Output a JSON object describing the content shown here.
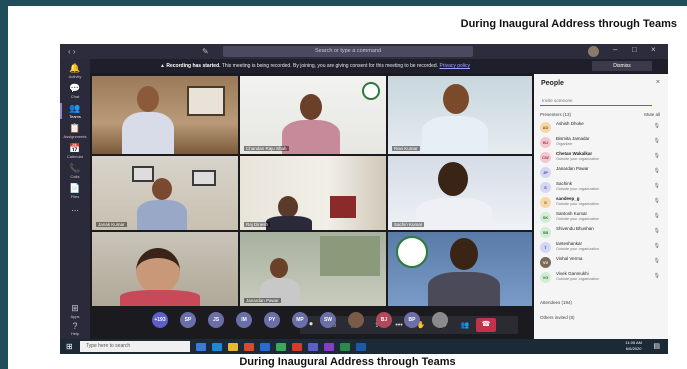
{
  "captions": {
    "top": "During Inaugural Address through Teams",
    "bottom": "During Inaugural Address through Teams"
  },
  "titlebar": {
    "search_placeholder": "Search or type a command"
  },
  "rail": [
    {
      "label": "Activity",
      "icon": "bell-icon"
    },
    {
      "label": "Chat",
      "icon": "chat-icon"
    },
    {
      "label": "Teams",
      "icon": "teams-icon",
      "active": true
    },
    {
      "label": "Assignments",
      "icon": "assignments-icon"
    },
    {
      "label": "Calendar",
      "icon": "calendar-icon"
    },
    {
      "label": "Calls",
      "icon": "phone-icon"
    },
    {
      "label": "Files",
      "icon": "files-icon"
    },
    {
      "label": "...",
      "icon": "more-icon"
    },
    {
      "label": "Apps",
      "icon": "apps-icon"
    },
    {
      "label": "Help",
      "icon": "help-icon"
    }
  ],
  "banner": {
    "bold": "Recording has started.",
    "text": " This meeting is being recorded. By joining, you are giving consent for this meeting to be recorded.",
    "link": "Privacy policy",
    "dismiss": "Dismiss"
  },
  "tiles": [
    {
      "name": ""
    },
    {
      "name": "Chandan Raju Shah"
    },
    {
      "name": "Ravi Kumar"
    },
    {
      "name": "Janak Kumar"
    },
    {
      "name": "Raj Dinesh"
    },
    {
      "name": "Sachin Kumar"
    },
    {
      "name": ""
    },
    {
      "name": "Janardan Pawar"
    },
    {
      "name": ""
    }
  ],
  "avatars": [
    {
      "text": "+193",
      "color": "#5b5fc7"
    },
    {
      "text": "SP",
      "color": "#6b6fa8"
    },
    {
      "text": "JS",
      "color": "#6b6fa8"
    },
    {
      "text": "IM",
      "color": "#6b6fa8"
    },
    {
      "text": "PY",
      "color": "#6b6fa8"
    },
    {
      "text": "MP",
      "color": "#6b6fa8"
    },
    {
      "text": "SW",
      "color": "#6b6fa8"
    },
    {
      "text": "",
      "color": "#7a5b4a"
    },
    {
      "text": "BJ",
      "color": "#b04a5a"
    },
    {
      "text": "BP",
      "color": "#6b6fa8"
    },
    {
      "text": "",
      "color": "#8a8a8a"
    }
  ],
  "people": {
    "title": "People",
    "invite_placeholder": "Invite someone",
    "presenters_label": "Presenters (13)",
    "mute_all": "Mute all",
    "attendees_label": "Attendees (194)",
    "others_label": "Others invited (8)",
    "list": [
      {
        "initials": "AD",
        "name": "Ashish Dhoke",
        "role": "",
        "bg": "#f6d7a8",
        "fg": "#8a5a1a"
      },
      {
        "initials": "BJ",
        "name": "Bismita Jamadar",
        "role": "Organizer",
        "bg": "#f3c7cf",
        "fg": "#a03040"
      },
      {
        "initials": "CW",
        "name": "Chetan Wakalkar",
        "role": "Outside your organization",
        "bg": "#f3c7cf",
        "fg": "#a03040"
      },
      {
        "initials": "JP",
        "name": "Janardan Pawar",
        "role": "",
        "bg": "#d5d6f3",
        "fg": "#4a4ca0"
      },
      {
        "initials": "S",
        "name": "Sachink",
        "role": "Outside your organization",
        "bg": "#d5d6f3",
        "fg": "#4a4ca0"
      },
      {
        "initials": "S",
        "name": "sandeep_g",
        "role": "Outside your organization",
        "bg": "#f6d7a8",
        "fg": "#8a5a1a"
      },
      {
        "initials": "SK",
        "name": "Santosh Kumar",
        "role": "Outside your organization",
        "bg": "#d2ecd6",
        "fg": "#2f7a3f"
      },
      {
        "initials": "SB",
        "name": "Shivendu Bhushan",
        "role": "",
        "bg": "#d2ecd6",
        "fg": "#2f7a3f"
      },
      {
        "initials": "T",
        "name": "tanteshankar",
        "role": "Outside your organization",
        "bg": "#d5d6f3",
        "fg": "#4a4ca0"
      },
      {
        "initials": "VV",
        "name": "Vishal Verma",
        "role": "",
        "bg": "#7a6a5a",
        "fg": "#ffffff"
      },
      {
        "initials": "VG",
        "name": "Vivek Ganmukhi",
        "role": "Outside your organization",
        "bg": "#d2ecd6",
        "fg": "#2f7a3f"
      }
    ]
  },
  "taskbar": {
    "search_placeholder": "Type here to search",
    "time": "11:05 AM",
    "date": "6/6/2020"
  }
}
